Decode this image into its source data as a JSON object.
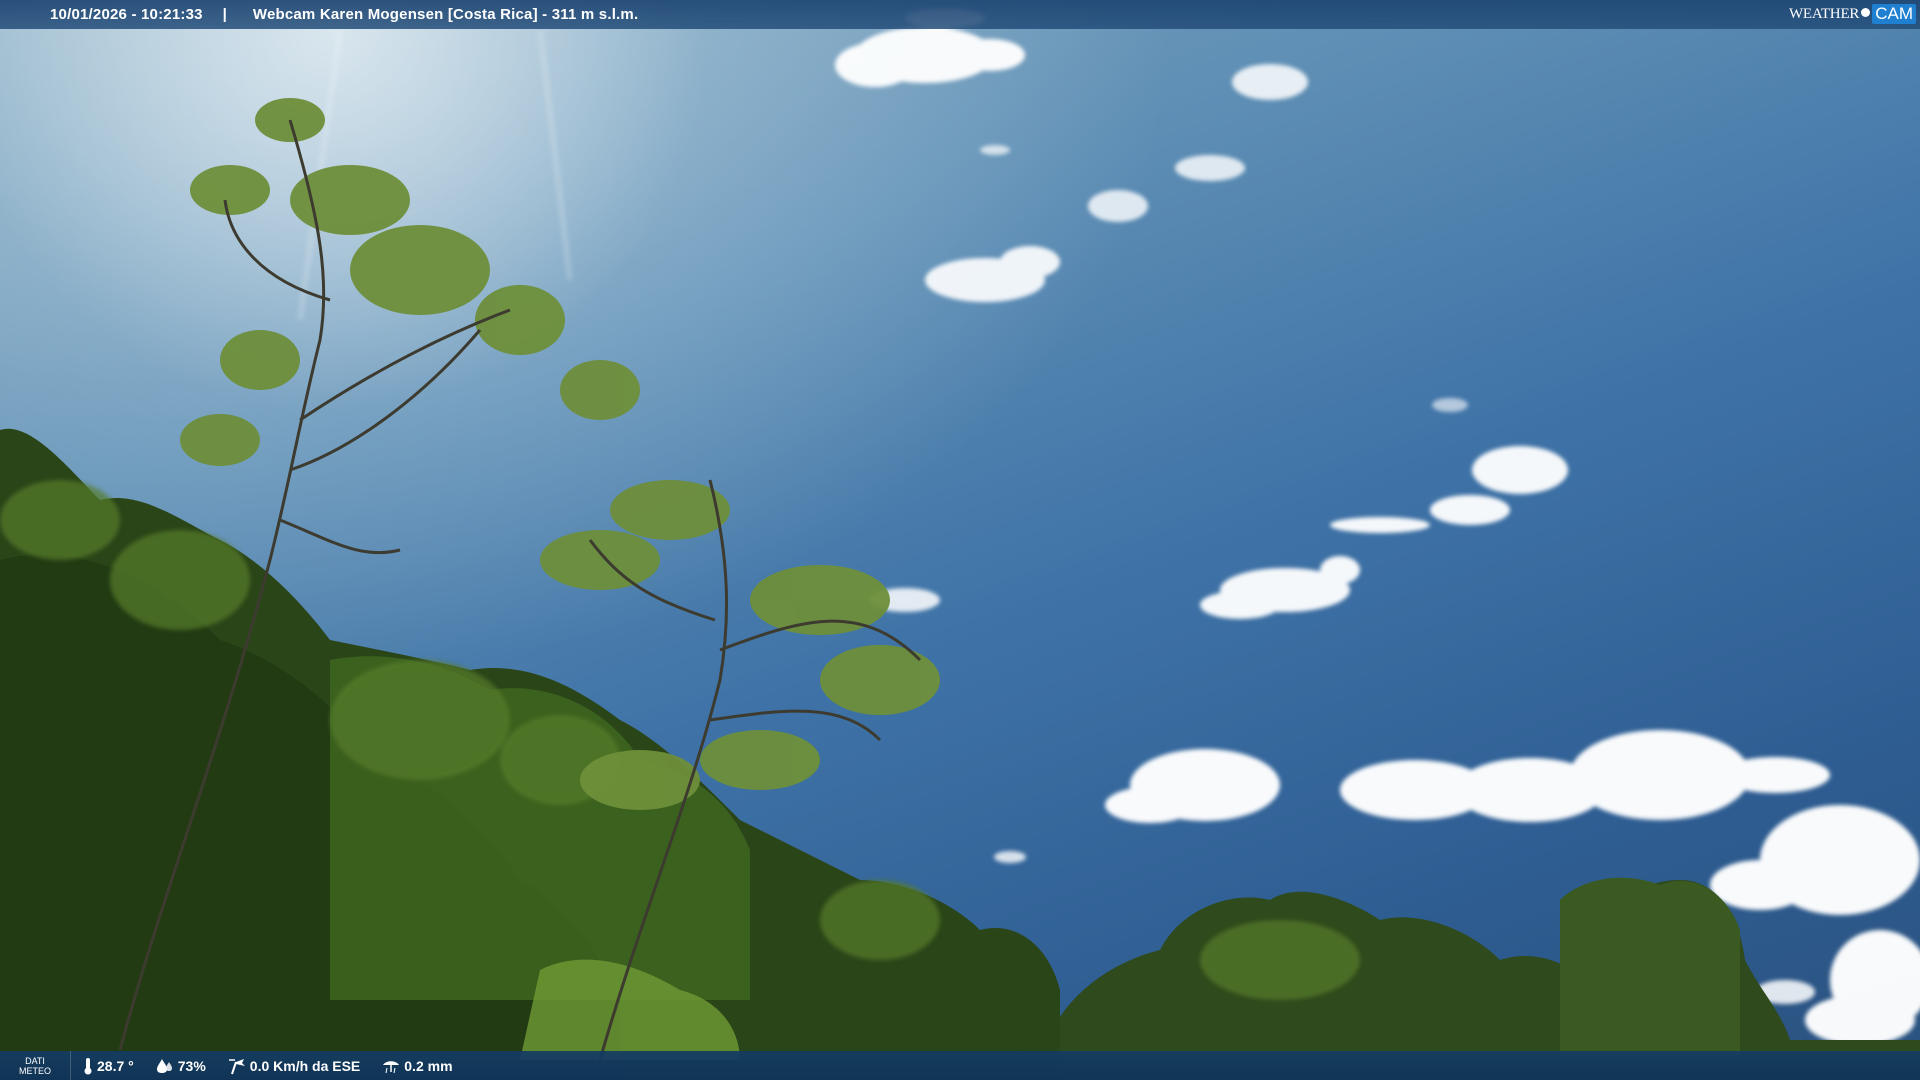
{
  "header": {
    "datetime": "10/01/2026 - 10:21:33",
    "separator": "|",
    "title": "Webcam Karen Mogensen [Costa Rica] - 311 m s.l.m."
  },
  "brand": {
    "weather": "WEATHER",
    "cam": "CAM"
  },
  "weather_bar": {
    "section_label_line1": "DATI",
    "section_label_line2": "METEO",
    "temperature": "28.7 °",
    "humidity": "73%",
    "wind": "0.0 Km/h da ESE",
    "rain": "0.2 mm"
  },
  "icons": {
    "temperature": "thermometer-icon",
    "humidity": "droplet-icon",
    "wind": "wind-icon",
    "rain": "rain-icon"
  },
  "colors": {
    "bar_bg": "#1e4673",
    "brand_cam_bg": "#1f7fd0",
    "text": "#ffffff"
  }
}
